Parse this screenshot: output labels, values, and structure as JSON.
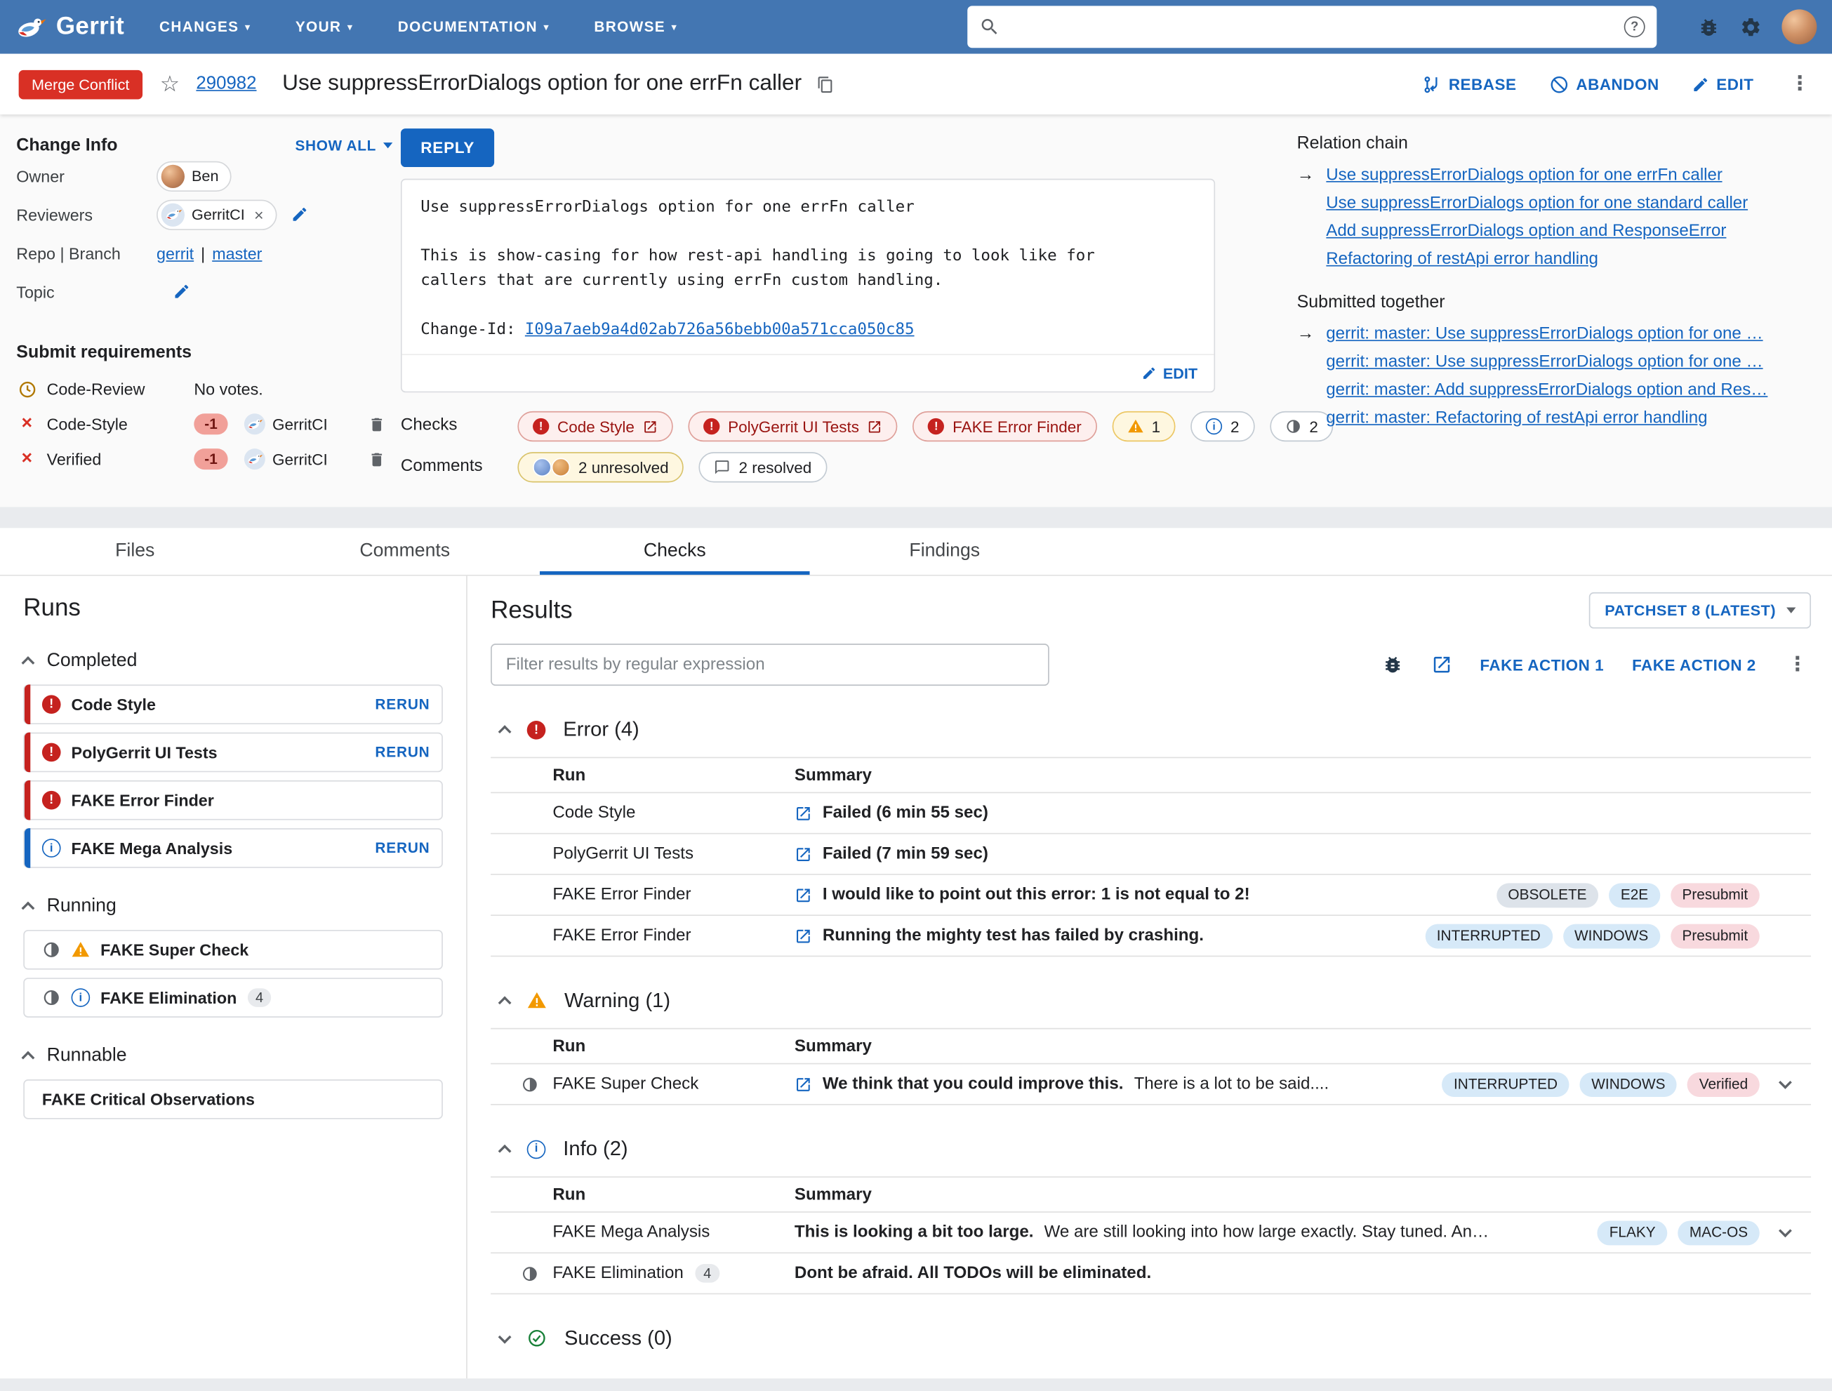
{
  "theme": {
    "header_blue": "#4376b2",
    "accent_blue": "#1565c0",
    "error_red": "#c5221f",
    "badge_red": "#d93025",
    "warning_orange": "#f29900",
    "success_green": "#188038"
  },
  "icons": {
    "caret_down": "▾",
    "overflow_menu": "⋮",
    "arrow_right": "→",
    "close": "×",
    "star": "☆"
  },
  "navbar": {
    "brand": "Gerrit",
    "menu_changes": "CHANGES",
    "menu_your": "YOUR",
    "menu_documentation": "DOCUMENTATION",
    "menu_browse": "BROWSE",
    "search_placeholder": ""
  },
  "change_header": {
    "status_badge": "Merge Conflict",
    "change_number": "290982",
    "title": "Use suppressErrorDialogs option for one errFn caller",
    "rebase": "REBASE",
    "abandon": "ABANDON",
    "edit": "EDIT"
  },
  "change_info": {
    "heading": "Change Info",
    "show_all": "SHOW ALL",
    "owner_label": "Owner",
    "owner_name": "Ben",
    "reviewers_label": "Reviewers",
    "reviewer_name": "GerritCI",
    "repo_branch_label": "Repo | Branch",
    "repo": "gerrit",
    "branch_separator": "|",
    "branch": "master",
    "topic_label": "Topic",
    "submit_requirements_heading": "Submit requirements",
    "code_review_label": "Code-Review",
    "code_review_value": "No votes.",
    "code_style_label": "Code-Style",
    "code_style_vote": "-1",
    "code_style_account": "GerritCI",
    "verified_label": "Verified",
    "verified_vote": "-1",
    "verified_account": "GerritCI"
  },
  "commit": {
    "reply": "REPLY",
    "message": "Use suppressErrorDialogs option for one errFn caller\n\nThis is show-casing for how rest-api handling is going to look like for\ncallers that are currently using errFn custom handling.",
    "change_id_label": "Change-Id:",
    "change_id": "I09a7aeb9a4d02ab726a56bebb00a571cca050c85",
    "edit": "EDIT"
  },
  "summary": {
    "checks_label": "Checks",
    "check_error_chips": [
      "Code Style",
      "PolyGerrit UI Tests",
      "FAKE Error Finder"
    ],
    "warning_count": "1",
    "info_count": "2",
    "running_count": "2",
    "comments_label": "Comments",
    "unresolved_label": "2 unresolved",
    "resolved_label": "2 resolved"
  },
  "relation_chain": {
    "heading": "Relation chain",
    "links": [
      "Use suppressErrorDialogs option for one errFn caller",
      "Use suppressErrorDialogs option for one standard caller",
      "Add suppressErrorDialogs option and ResponseError",
      "Refactoring of restApi error handling"
    ],
    "submitted_heading": "Submitted together",
    "submitted_links": [
      "gerrit: master: Use suppressErrorDialogs option for one …",
      "gerrit: master: Use suppressErrorDialogs option for one …",
      "gerrit: master: Add suppressErrorDialogs option and Res…",
      "gerrit: master: Refactoring of restApi error handling"
    ]
  },
  "tabs": {
    "files": "Files",
    "comments": "Comments",
    "checks": "Checks",
    "findings": "Findings"
  },
  "runs": {
    "heading": "Runs",
    "rerun_label": "RERUN",
    "completed_heading": "Completed",
    "completed_items": [
      "Code Style",
      "PolyGerrit UI Tests",
      "FAKE Error Finder",
      "FAKE Mega Analysis"
    ],
    "running_heading": "Running",
    "running_items": [
      "FAKE Super Check",
      "FAKE Elimination"
    ],
    "elimination_count": "4",
    "runnable_heading": "Runnable",
    "runnable_items": [
      "FAKE Critical Observations"
    ]
  },
  "results": {
    "heading": "Results",
    "patchset": "PATCHSET 8 (LATEST)",
    "filter_placeholder": "Filter results by regular expression",
    "action1": "FAKE ACTION 1",
    "action2": "FAKE ACTION 2",
    "col_run": "Run",
    "col_summary": "Summary",
    "error_title": "Error (4)",
    "warning_title": "Warning (1)",
    "info_title": "Info (2)",
    "success_title": "Success (0)",
    "error_rows": [
      {
        "run": "Code Style",
        "summary": "Failed (6 min 55 sec)"
      },
      {
        "run": "PolyGerrit UI Tests",
        "summary": "Failed (7 min 59 sec)"
      },
      {
        "run": "FAKE Error Finder",
        "summary": "I would like to point out this error: 1 is not equal to 2!",
        "tag1": "OBSOLETE",
        "tag2": "E2E",
        "tag3": "Presubmit"
      },
      {
        "run": "FAKE Error Finder",
        "summary": "Running the mighty test has failed by crashing.",
        "tag1": "INTERRUPTED",
        "tag2": "WINDOWS",
        "tag3": "Presubmit"
      }
    ],
    "warning_row": {
      "run": "FAKE Super Check",
      "summary_bold": "We think that you could improve this.",
      "summary_rest": "There is a lot to be said....",
      "tag1": "INTERRUPTED",
      "tag2": "WINDOWS",
      "tag3": "Verified"
    },
    "info_row1": {
      "run": "FAKE Mega Analysis",
      "summary_bold": "This is looking a bit too large.",
      "summary_rest": "We are still looking into how large exactly. Stay tuned. An…",
      "tag1": "FLAKY",
      "tag2": "MAC-OS"
    },
    "info_row2": {
      "run": "FAKE Elimination",
      "count": "4",
      "summary_bold": "Dont be afraid. All TODOs will be eliminated."
    }
  }
}
